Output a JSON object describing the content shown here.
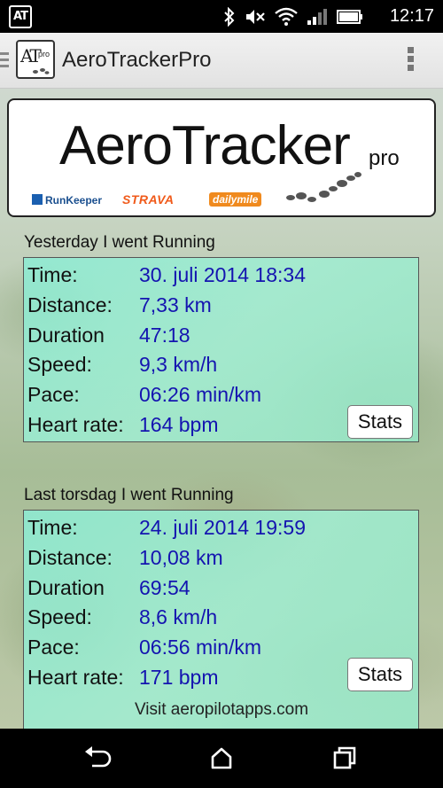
{
  "statusbar": {
    "app_icon_text": "AT",
    "time": "12:17",
    "icons": [
      "bluetooth-icon",
      "mute-icon",
      "wifi-icon",
      "signal-icon",
      "battery-icon"
    ]
  },
  "actionbar": {
    "title": "AeroTrackerPro",
    "logo_text": "AT",
    "logo_sub": "pro"
  },
  "banner": {
    "title": "AeroTracker",
    "pro": "pro",
    "partners": [
      "RunKeeper",
      "STRAVA",
      "dailymile"
    ]
  },
  "activities": [
    {
      "heading": "Yesterday I went Running",
      "rows": [
        {
          "label": "Time:",
          "value": "30. juli 2014 18:34"
        },
        {
          "label": "Distance:",
          "value": "7,33 km"
        },
        {
          "label": "Duration",
          "value": "47:18"
        },
        {
          "label": "Speed:",
          "value": "9,3 km/h"
        },
        {
          "label": "Pace:",
          "value": "06:26 min/km"
        },
        {
          "label": "Heart rate:",
          "value": "164 bpm"
        }
      ],
      "stats_label": "Stats"
    },
    {
      "heading": "Last torsdag I went Running",
      "rows": [
        {
          "label": "Time:",
          "value": "24. juli 2014 19:59"
        },
        {
          "label": "Distance:",
          "value": "10,08 km"
        },
        {
          "label": "Duration",
          "value": "69:54"
        },
        {
          "label": "Speed:",
          "value": "8,6 km/h"
        },
        {
          "label": "Pace:",
          "value": "06:56 min/km"
        },
        {
          "label": "Heart rate:",
          "value": "171 bpm"
        }
      ],
      "stats_label": "Stats"
    }
  ],
  "footer": {
    "link": "Visit aeropilotapps.com"
  },
  "navbar": {
    "icons": [
      "back-icon",
      "home-icon",
      "recent-apps-icon"
    ]
  },
  "colors": {
    "value_text": "#1414b0",
    "card_bg": "#8cecd4",
    "strava": "#f05a1a",
    "dailymile": "#f08a1e",
    "runkeeper": "#1a4f8f"
  }
}
